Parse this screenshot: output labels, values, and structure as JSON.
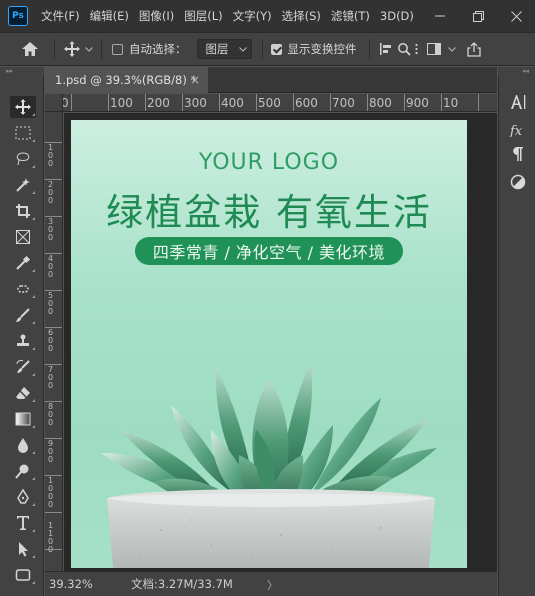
{
  "menubar": {
    "app_icon": "Ps",
    "items": [
      "文件(F)",
      "编辑(E)",
      "图像(I)",
      "图层(L)",
      "文字(Y)",
      "选择(S)",
      "滤镜(T)",
      "3D(D)"
    ],
    "window_controls": [
      "minimize-icon",
      "restore-icon",
      "close-icon"
    ]
  },
  "optionsbar": {
    "auto_select_label": "自动选择：",
    "auto_select_checked": false,
    "auto_select_target": "图层",
    "show_transform_label": "显示变换控件",
    "show_transform_checked": true,
    "more_label": "···"
  },
  "document": {
    "tab_label": "1.psd @ 39.3%(RGB/8) *",
    "close_glyph": "×",
    "ruler_h": [
      "0",
      "100",
      "200",
      "300",
      "400",
      "500",
      "600",
      "700",
      "800",
      "900",
      "10"
    ],
    "ruler_v": [
      "1",
      "0",
      "0",
      "2",
      "0",
      "0",
      "3",
      "0",
      "0",
      "4",
      "0",
      "0",
      "5",
      "0",
      "0",
      "6",
      "0",
      "0",
      "7",
      "0",
      "0",
      "8",
      "0",
      "0",
      "9",
      "0",
      "0",
      "1",
      "0",
      "0",
      "0",
      "1",
      "1",
      "0",
      "0"
    ]
  },
  "canvas": {
    "logo": "YOUR LOGO",
    "headline": "绿植盆栽 有氧生活",
    "tagline": "四季常青 / 净化空气 / 美化环境",
    "accent_color": "#1f8a53",
    "background_color": "#a9e2cb"
  },
  "statusbar": {
    "zoom": "39.32%",
    "doc_size": "文档:3.27M/33.7M",
    "arrow": "〉"
  },
  "tools": [
    "move-tool-icon",
    "marquee-tool-icon",
    "lasso-tool-icon",
    "magic-wand-icon",
    "crop-tool-icon",
    "frame-tool-icon",
    "eyedropper-icon",
    "healing-brush-icon",
    "brush-tool-icon",
    "clone-stamp-icon",
    "history-brush-icon",
    "eraser-icon",
    "gradient-tool-icon",
    "blur-tool-icon",
    "dodge-tool-icon",
    "pen-tool-icon",
    "type-tool-icon",
    "path-selection-icon",
    "rectangle-tool-icon"
  ],
  "right_panel_icons": [
    "character-panel-icon",
    "fx-styles-icon",
    "paragraph-panel-icon",
    "adjustments-icon"
  ]
}
